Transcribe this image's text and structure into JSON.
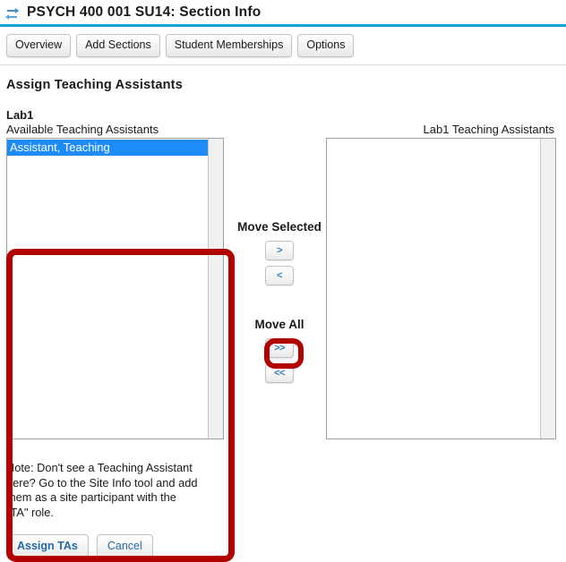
{
  "header": {
    "icon": "exchange-arrows-icon",
    "title": "PSYCH 400 001 SU14: Section Info",
    "rule_color": "#1c9fd4"
  },
  "tabs": [
    {
      "label": "Overview"
    },
    {
      "label": "Add Sections"
    },
    {
      "label": "Student Memberships"
    },
    {
      "label": "Options"
    }
  ],
  "main": {
    "section_heading": "Assign Teaching Assistants",
    "group_label": "Lab1",
    "available": {
      "label": "Available Teaching Assistants",
      "items": [
        {
          "label": "Assistant, Teaching",
          "selected": true
        }
      ]
    },
    "assigned": {
      "label": "Lab1 Teaching Assistants",
      "items": []
    },
    "transfer": {
      "move_selected_label": "Move Selected",
      "move_right": ">",
      "move_left": "<",
      "move_all_label": "Move All",
      "move_all_right": ">>",
      "move_all_left": "<<"
    },
    "note": "Note: Don't see a Teaching Assistant here? Go to the Site Info tool and add them as a site participant with the \"TA\" role."
  },
  "footer": {
    "assign_label": "Assign TAs",
    "cancel_label": "Cancel"
  },
  "annotations": {
    "color": "#b00000",
    "targets": [
      "available-teaching-assistants-list",
      "move-selected-right-button"
    ]
  },
  "colors": {
    "accent_rule": "#1c9fd4",
    "selection": "#1e8bfa",
    "annotation_red": "#b00000",
    "button_text_blue": "#2469a8"
  }
}
